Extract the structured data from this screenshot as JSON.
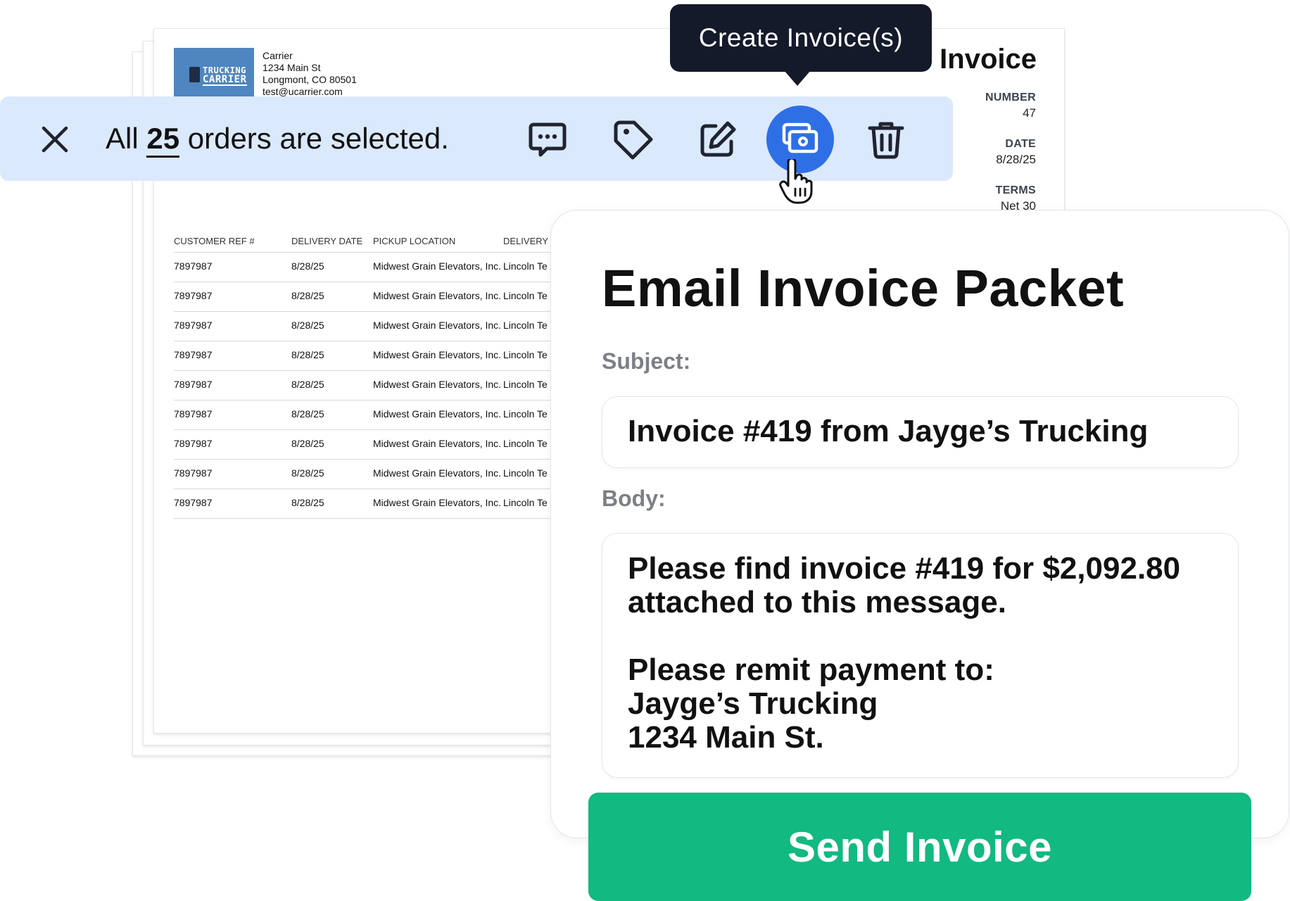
{
  "invoice": {
    "logo": {
      "line1": "TRUCKING",
      "line2": "CARRIER"
    },
    "carrier": {
      "name": "Carrier",
      "street": "1234 Main St",
      "city": "Longmont, CO 80501",
      "email": "test@ucarrier.com"
    },
    "title": "Invoice",
    "number_label": "NUMBER",
    "number_value": "47",
    "date_label": "DATE",
    "date_value": "8/28/25",
    "terms_label": "TERMS",
    "terms_value": "Net 30",
    "table": {
      "headers": [
        "CUSTOMER REF #",
        "DELIVERY DATE",
        "PICKUP LOCATION",
        "DELIVERY"
      ],
      "rows": [
        [
          "7897987",
          "8/28/25",
          "Midwest Grain Elevators, Inc.",
          "Lincoln Te"
        ],
        [
          "7897987",
          "8/28/25",
          "Midwest Grain Elevators, Inc.",
          "Lincoln Te"
        ],
        [
          "7897987",
          "8/28/25",
          "Midwest Grain Elevators, Inc.",
          "Lincoln Te"
        ],
        [
          "7897987",
          "8/28/25",
          "Midwest Grain Elevators, Inc.",
          "Lincoln Te"
        ],
        [
          "7897987",
          "8/28/25",
          "Midwest Grain Elevators, Inc.",
          "Lincoln Te"
        ],
        [
          "7897987",
          "8/28/25",
          "Midwest Grain Elevators, Inc.",
          "Lincoln Te"
        ],
        [
          "7897987",
          "8/28/25",
          "Midwest Grain Elevators, Inc.",
          "Lincoln Te"
        ],
        [
          "7897987",
          "8/28/25",
          "Midwest Grain Elevators, Inc.",
          "Lincoln Te"
        ],
        [
          "7897987",
          "8/28/25",
          "Midwest Grain Elevators, Inc.",
          "Lincoln Te"
        ]
      ]
    }
  },
  "selection_bar": {
    "text_before": "All",
    "count": "25",
    "text_after": "orders are selected.",
    "icons": [
      "close-icon",
      "comment-icon",
      "tag-icon",
      "edit-icon",
      "create-invoice-icon",
      "trash-icon"
    ],
    "colors": {
      "background": "#dbe9fd",
      "active_button": "#2f6fe6"
    }
  },
  "tooltip": {
    "text": "Create Invoice(s)"
  },
  "email_panel": {
    "title": "Email Invoice Packet",
    "subject_label": "Subject:",
    "subject_value": "Invoice #419 from Jayge’s Trucking",
    "body_label": "Body:",
    "body_line1": "Please find invoice #419 for $2,092.80",
    "body_line2": "attached to this message.",
    "body_line3": "Please remit payment to:",
    "body_line4": "Jayge’s Trucking",
    "body_line5": "1234 Main St.",
    "send_label": "Send Invoice",
    "colors": {
      "send_button": "#12b981"
    }
  }
}
